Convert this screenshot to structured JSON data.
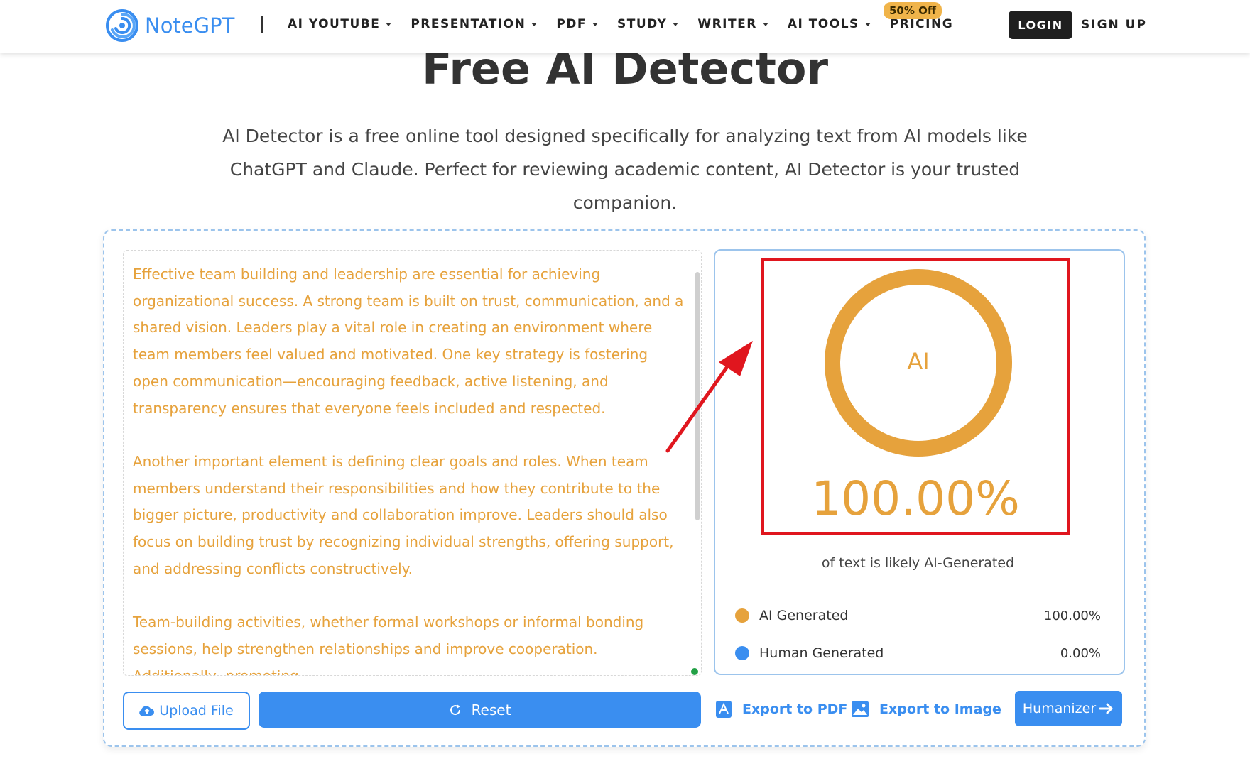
{
  "brand": {
    "name": "NoteGPT"
  },
  "nav": {
    "items": [
      {
        "label": "AI YOUTUBE",
        "dropdown": true
      },
      {
        "label": "PRESENTATION",
        "dropdown": true
      },
      {
        "label": "PDF",
        "dropdown": true
      },
      {
        "label": "STUDY",
        "dropdown": true
      },
      {
        "label": "WRITER",
        "dropdown": true
      },
      {
        "label": "AI TOOLS",
        "dropdown": true
      },
      {
        "label": "PRICING",
        "dropdown": false
      }
    ],
    "pricing_badge": "50% Off",
    "login_label": "LOGIN",
    "signup_label": "SIGN UP"
  },
  "hero": {
    "title": "Free AI Detector",
    "description": "AI Detector is a free online tool designed specifically for analyzing text from AI models like ChatGPT and Claude. Perfect for reviewing academic content, AI Detector is your trusted companion."
  },
  "input": {
    "paragraphs": [
      "Effective team building and leadership are essential for achieving organizational success. A strong team is built on trust, communication, and a shared vision. Leaders play a vital role in creating an environment where team members feel valued and motivated. One key strategy is fostering open communication—encouraging feedback, active listening, and transparency ensures that everyone feels included and respected.",
      "Another important element is defining clear goals and roles. When team members understand their responsibilities and how they contribute to the bigger picture, productivity and collaboration improve. Leaders should also focus on building trust by recognizing individual strengths, offering support, and addressing conflicts constructively.",
      "Team-building activities, whether formal workshops or informal bonding sessions, help strengthen relationships and improve cooperation. Additionally, promoting"
    ]
  },
  "result": {
    "ring_label": "AI",
    "ai_fraction": 1.0,
    "percent_text": "100.00%",
    "caption": "of text is likely AI-Generated",
    "legend": [
      {
        "label": "AI Generated",
        "value": "100.00%",
        "color": "#e6a23c"
      },
      {
        "label": "Human Generated",
        "value": "0.00%",
        "color": "#3a8ef0"
      }
    ]
  },
  "actions": {
    "upload_label": "Upload File",
    "reset_label": "Reset",
    "export_pdf_label": "Export to PDF",
    "export_image_label": "Export to Image",
    "humanizer_label": "Humanizer"
  },
  "colors": {
    "accent": "#3a8ef0",
    "ai": "#e6a23c",
    "highlight": "#e0161e"
  }
}
